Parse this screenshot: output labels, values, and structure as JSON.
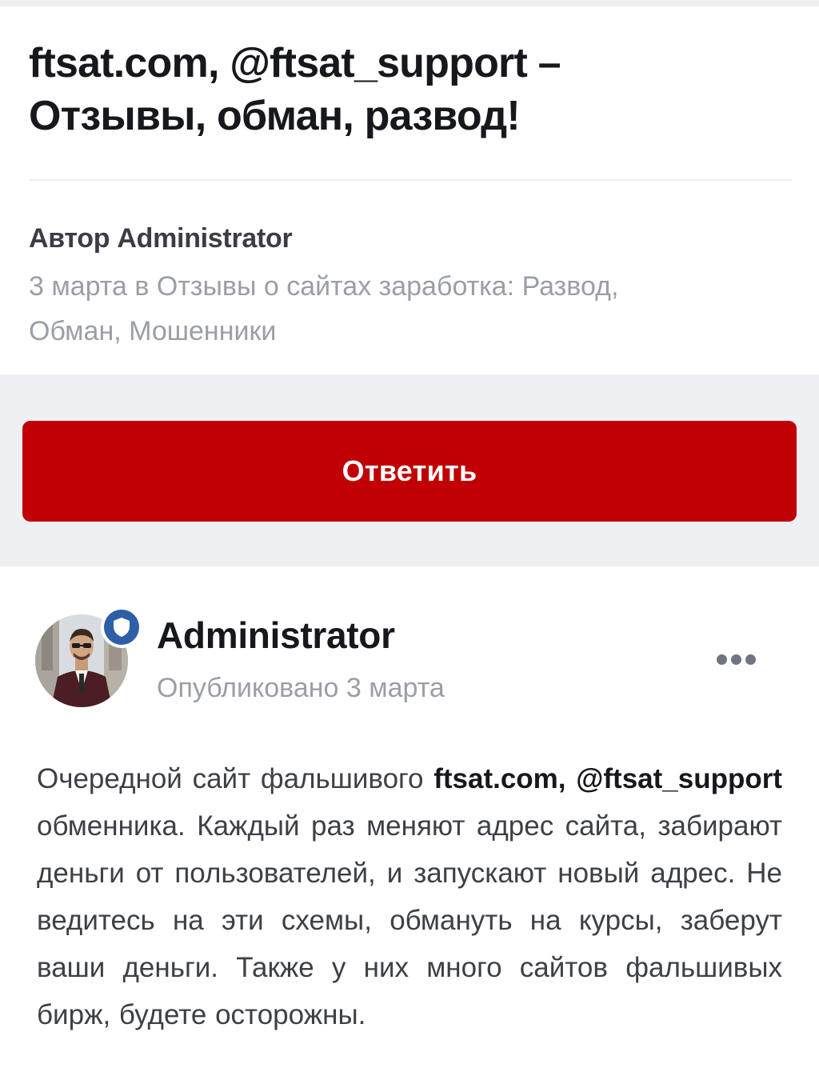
{
  "topic": {
    "title_line1": "ftsat.com, @ftsat_support –",
    "title_line2": "Отзывы, обман, развод!",
    "author_line": "Автор Administrator",
    "meta_line1": "3 марта в Отзывы о сайтах заработка: Развод,",
    "meta_line2": "Обман, Мошенники"
  },
  "reply_button": {
    "label": "Ответить"
  },
  "post": {
    "author_name": "Administrator",
    "posted_label": "Опубликовано 3 марта",
    "body": {
      "intro": "Очередной сайт фальшивого ",
      "bold_site": "ftsat.com,",
      "bold_handle": "@ftsat_support",
      "rest": " обменника. Каждый раз меняют адрес сайта, забирают деньги от пользователей, и запускают новый адрес. Не ведитесь на эти схемы, обмануть на курсы, заберут ваши деньги. Также у них много сайтов фальшивых бирж, будете осторожны."
    }
  },
  "colors": {
    "accent_red": "#c00004",
    "badge_blue": "#2d5fa6",
    "muted_text": "#9a9ea7",
    "page_bg": "#eef0f4"
  },
  "icons": {
    "badge": "shield-icon",
    "more": "more-dots-icon"
  }
}
